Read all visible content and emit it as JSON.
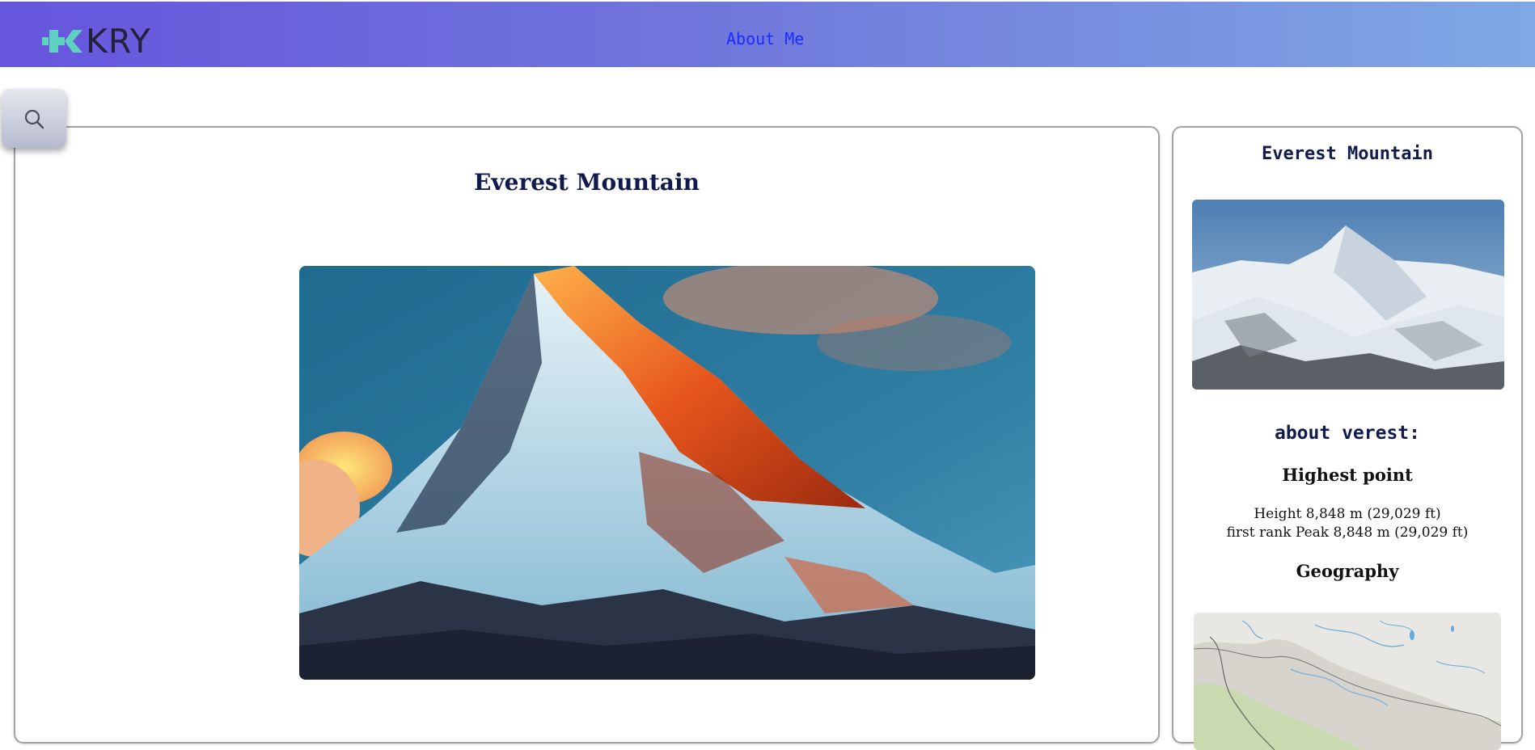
{
  "header": {
    "logo_text": "KRY",
    "nav_about": "About Me",
    "colors": {
      "gradient_start": "#6655dd",
      "gradient_end": "#7fa8e4",
      "logo_mark": "#5fd1c1",
      "link": "#1a2cff"
    }
  },
  "search": {
    "icon": "search-icon"
  },
  "main": {
    "title": "Everest Mountain",
    "photo": "mountain-photo-sunset"
  },
  "sidebar": {
    "title": "Everest Mountain",
    "photo": "mountain-photo-snow",
    "about_heading": "about verest:",
    "highest_point": {
      "heading": "Highest point",
      "lines": [
        "Height 8,848 m (29,029 ft)",
        "first rank Peak 8,848 m (29,029 ft)"
      ]
    },
    "geography": {
      "heading": "Geography",
      "map": "terrain-map"
    }
  }
}
